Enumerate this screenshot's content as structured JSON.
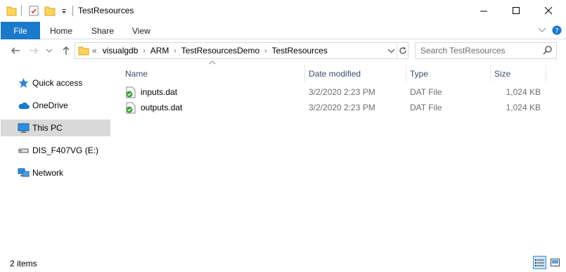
{
  "window": {
    "title": "TestResources",
    "minimize_icon": "minimize-icon",
    "maximize_icon": "maximize-icon",
    "close_icon": "close-icon"
  },
  "ribbon": {
    "tabs": [
      {
        "label": "File",
        "active": true
      },
      {
        "label": "Home"
      },
      {
        "label": "Share"
      },
      {
        "label": "View"
      }
    ]
  },
  "address": {
    "overflow": "«",
    "crumbs": [
      "visualgdb",
      "ARM",
      "TestResourcesDemo",
      "TestResources"
    ]
  },
  "search": {
    "placeholder": "Search TestResources"
  },
  "nav": {
    "items": [
      {
        "label": "Quick access",
        "icon": "star-icon"
      },
      {
        "label": "OneDrive",
        "icon": "cloud-icon"
      },
      {
        "label": "This PC",
        "icon": "computer-icon",
        "selected": true
      },
      {
        "label": "DIS_F407VG (E:)",
        "icon": "drive-icon"
      },
      {
        "label": "Network",
        "icon": "network-icon"
      }
    ]
  },
  "columns": {
    "name": "Name",
    "date": "Date modified",
    "type": "Type",
    "size": "Size"
  },
  "files": [
    {
      "name": "inputs.dat",
      "date": "3/2/2020 2:23 PM",
      "type": "DAT File",
      "size": "1,024 KB"
    },
    {
      "name": "outputs.dat",
      "date": "3/2/2020 2:23 PM",
      "type": "DAT File",
      "size": "1,024 KB"
    }
  ],
  "status": {
    "count": "2 items"
  },
  "colors": {
    "file_tab": "#1979ca",
    "selected_nav": "#d9d9d9",
    "header_text": "#3b4d6b",
    "folder": "#ffd35c"
  }
}
